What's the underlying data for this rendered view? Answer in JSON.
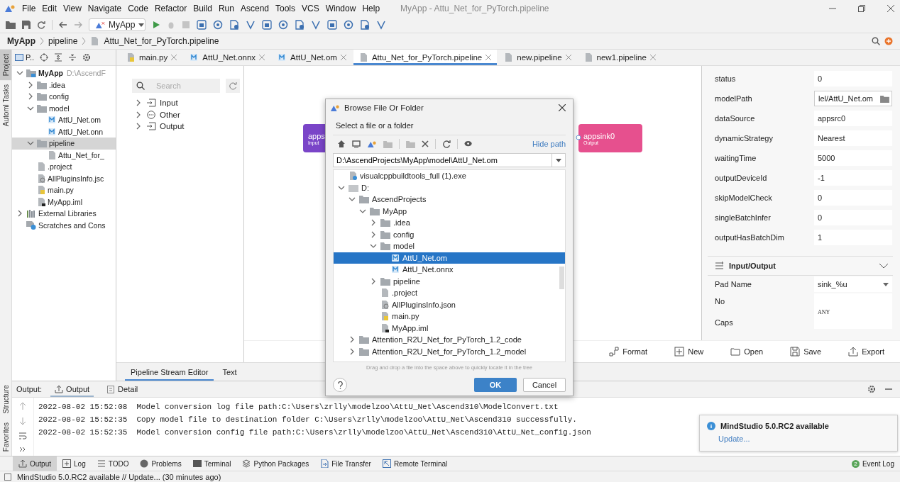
{
  "window": {
    "title": "MyApp - Attu_Net_for_PyTorch.pipeline",
    "menu": [
      "File",
      "Edit",
      "View",
      "Navigate",
      "Code",
      "Refactor",
      "Build",
      "Run",
      "Ascend",
      "Tools",
      "VCS",
      "Window",
      "Help"
    ]
  },
  "toolbar": {
    "run_config": "MyApp"
  },
  "breadcrumb": [
    "MyApp",
    "pipeline",
    "Attu_Net_for_PyTorch.pipeline"
  ],
  "side_strip": {
    "top": [
      {
        "label": "Project",
        "selected": true
      },
      {
        "label": "Automl Tasks",
        "selected": false
      }
    ],
    "bottom": [
      {
        "label": "Structure",
        "selected": false
      },
      {
        "label": "Favorites",
        "selected": false
      }
    ]
  },
  "project_panel": {
    "tab": "P..",
    "tree": [
      {
        "label": "MyApp",
        "path": "D:\\AscendF",
        "kind": "root",
        "expanded": true,
        "selected": false,
        "children": [
          {
            "label": ".idea",
            "kind": "folder",
            "expanded": false,
            "selected": false
          },
          {
            "label": "config",
            "kind": "folder",
            "expanded": false,
            "selected": false
          },
          {
            "label": "model",
            "kind": "folder",
            "expanded": true,
            "selected": false,
            "children": [
              {
                "label": "AttU_Net.om",
                "kind": "model",
                "selected": false
              },
              {
                "label": "AttU_Net.onn",
                "kind": "model",
                "selected": false
              }
            ]
          },
          {
            "label": "pipeline",
            "kind": "folder",
            "expanded": true,
            "selected": true,
            "children": [
              {
                "label": "Attu_Net_for_",
                "kind": "doc",
                "selected": false
              }
            ]
          },
          {
            "label": ".project",
            "kind": "doc",
            "selected": false
          },
          {
            "label": "AllPluginsInfo.jsc",
            "kind": "json",
            "selected": false
          },
          {
            "label": "main.py",
            "kind": "python",
            "selected": false
          },
          {
            "label": "MyApp.iml",
            "kind": "iml",
            "selected": false
          }
        ]
      },
      {
        "label": "External Libraries",
        "kind": "libraries",
        "expanded": false,
        "selected": false
      },
      {
        "label": "Scratches and Cons",
        "kind": "scratches",
        "selected": false
      }
    ]
  },
  "editor_tabs": [
    {
      "label": "main.py",
      "kind": "python",
      "selected": false
    },
    {
      "label": "AttU_Net.onnx",
      "kind": "model",
      "selected": false
    },
    {
      "label": "AttU_Net.om",
      "kind": "model",
      "selected": false
    },
    {
      "label": "Attu_Net_for_PyTorch.pipeline",
      "kind": "doc",
      "selected": true
    },
    {
      "label": "new.pipeline",
      "kind": "doc",
      "selected": false
    },
    {
      "label": "new1.pipeline",
      "kind": "doc",
      "selected": false
    }
  ],
  "palette": {
    "search_placeholder": "Search",
    "groups": [
      {
        "label": "Input",
        "kind": "input",
        "expanded": false
      },
      {
        "label": "Other",
        "kind": "other",
        "expanded": false
      },
      {
        "label": "Output",
        "kind": "output",
        "expanded": false
      }
    ]
  },
  "canvas": {
    "nodes": [
      {
        "name": "apps",
        "type": "Input",
        "color": "#7a45c8"
      },
      {
        "name": "appsink0",
        "type": "Output",
        "color": "#e6508e"
      }
    ],
    "actions": [
      {
        "label": "Format",
        "kind": "format"
      },
      {
        "label": "New",
        "kind": "new"
      },
      {
        "label": "Open",
        "kind": "open"
      },
      {
        "label": "Save",
        "kind": "save"
      },
      {
        "label": "Export",
        "kind": "export"
      }
    ]
  },
  "editor_mode_tabs": [
    {
      "label": "Pipeline Stream Editor",
      "selected": true
    },
    {
      "label": "Text",
      "selected": false
    }
  ],
  "properties": {
    "rows": [
      {
        "label": "status",
        "value": "0",
        "kind": "text"
      },
      {
        "label": "modelPath",
        "value": "lel/AttU_Net.om",
        "kind": "path"
      },
      {
        "label": "dataSource",
        "value": "appsrc0",
        "kind": "text"
      },
      {
        "label": "dynamicStrategy",
        "value": "Nearest",
        "kind": "text"
      },
      {
        "label": "waitingTime",
        "value": "5000",
        "kind": "text"
      },
      {
        "label": "outputDeviceId",
        "value": "-1",
        "kind": "text"
      },
      {
        "label": "skipModelCheck",
        "value": "0",
        "kind": "text"
      },
      {
        "label": "singleBatchInfer",
        "value": "0",
        "kind": "text"
      },
      {
        "label": "outputHasBatchDim",
        "value": "1",
        "kind": "text"
      }
    ],
    "section": {
      "title": "Input/Output",
      "expanded": true
    },
    "pads": [
      {
        "label": "Pad Name",
        "value": "sink_%u",
        "kind": "select"
      },
      {
        "label": "No",
        "kind": "text"
      },
      {
        "label": "Caps",
        "value": "ANY",
        "kind": "caps"
      }
    ]
  },
  "dialog": {
    "title": "Browse File Or Folder",
    "prompt": "Select a file or a folder",
    "hide_path": "Hide path",
    "path": "D:\\AscendProjects\\MyApp\\model\\AttU_Net.om",
    "tree": [
      {
        "label": "visualcppbuildtools_full (1).exe",
        "kind": "exe",
        "selected": false
      },
      {
        "label": "D:",
        "kind": "drive",
        "expanded": true,
        "selected": false,
        "children": [
          {
            "label": "AscendProjects",
            "kind": "folder",
            "expanded": true,
            "selected": false,
            "children": [
              {
                "label": "MyApp",
                "kind": "folder",
                "expanded": true,
                "selected": false,
                "children": [
                  {
                    "label": ".idea",
                    "kind": "folder",
                    "expanded": false,
                    "selected": false
                  },
                  {
                    "label": "config",
                    "kind": "folder",
                    "expanded": false,
                    "selected": false
                  },
                  {
                    "label": "model",
                    "kind": "folder",
                    "expanded": true,
                    "selected": false,
                    "children": [
                      {
                        "label": "AttU_Net.om",
                        "kind": "model",
                        "selected": true
                      },
                      {
                        "label": "AttU_Net.onnx",
                        "kind": "model",
                        "selected": false
                      }
                    ]
                  },
                  {
                    "label": "pipeline",
                    "kind": "folder",
                    "expanded": false,
                    "selected": false
                  },
                  {
                    "label": ".project",
                    "kind": "doc",
                    "selected": false
                  },
                  {
                    "label": "AllPluginsInfo.json",
                    "kind": "json",
                    "selected": false
                  },
                  {
                    "label": "main.py",
                    "kind": "python",
                    "selected": false
                  },
                  {
                    "label": "MyApp.iml",
                    "kind": "iml",
                    "selected": false
                  }
                ]
              }
            ]
          },
          {
            "label": "Attention_R2U_Net_for_PyTorch_1.2_code",
            "kind": "folder",
            "expanded": false,
            "selected": false
          },
          {
            "label": "Attention_R2U_Net_for_PyTorch_1.2_model",
            "kind": "folder",
            "expanded": false,
            "selected": false
          }
        ]
      }
    ],
    "hint": "Drag and drop a file into the space above to quickly locate it in the tree",
    "ok": "OK",
    "cancel": "Cancel"
  },
  "output": {
    "label": "Output:",
    "tabs": [
      {
        "label": "Output",
        "selected": true
      },
      {
        "label": "Detail",
        "selected": false
      }
    ],
    "lines": [
      {
        "time": "2022-08-02 15:52:08",
        "message": "Model conversion log file path:C:\\Users\\zrlly\\modelzoo\\AttU_Net\\Ascend310\\ModelConvert.txt"
      },
      {
        "time": "2022-08-02 15:52:35",
        "message": "Copy model file to destination folder C:\\Users\\zrlly\\modelzoo\\AttU_Net\\Ascend310 successfully."
      },
      {
        "time": "2022-08-02 15:52:35",
        "message": "Model conversion config file path:C:\\Users\\zrlly\\modelzoo\\AttU_Net\\Ascend310\\AttU_Net_config.json"
      }
    ]
  },
  "tool_tabs": [
    {
      "label": "Output",
      "kind": "output",
      "selected": true
    },
    {
      "label": "Log",
      "kind": "log",
      "selected": false
    },
    {
      "label": "TODO",
      "kind": "todo",
      "selected": false
    },
    {
      "label": "Problems",
      "kind": "problems",
      "selected": false
    },
    {
      "label": "Terminal",
      "kind": "terminal",
      "selected": false
    },
    {
      "label": "Python Packages",
      "kind": "packages",
      "selected": false
    },
    {
      "label": "File Transfer",
      "kind": "transfer",
      "selected": false
    },
    {
      "label": "Remote Terminal",
      "kind": "remote",
      "selected": false
    }
  ],
  "event_log": {
    "label": "Event Log",
    "count": "2"
  },
  "status_bar": "MindStudio 5.0.RC2 available // Update... (30 minutes ago)",
  "notification": {
    "title": "MindStudio 5.0.RC2 available",
    "link": "Update..."
  }
}
